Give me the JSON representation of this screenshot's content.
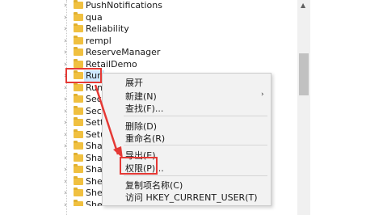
{
  "tree": {
    "items": [
      {
        "label": "PushNotifications"
      },
      {
        "label": "qua"
      },
      {
        "label": "Reliability"
      },
      {
        "label": "rempl"
      },
      {
        "label": "ReserveManager"
      },
      {
        "label": "RetailDemo"
      },
      {
        "label": "Run",
        "selected": true
      },
      {
        "label": "RunO"
      },
      {
        "label": "Secor"
      },
      {
        "label": "Secur"
      },
      {
        "label": "Settin"
      },
      {
        "label": "Setup"
      },
      {
        "label": "Share"
      },
      {
        "label": "Share"
      },
      {
        "label": "Share"
      },
      {
        "label": "Shell"
      },
      {
        "label": "Shell"
      },
      {
        "label": "ShellCompatibility"
      }
    ]
  },
  "context_menu": {
    "items": [
      {
        "label": "展开",
        "name": "menu-item-expand"
      },
      {
        "label": "新建(N)",
        "name": "menu-item-new",
        "has_submenu": true
      },
      {
        "label": "查找(F)...",
        "name": "menu-item-find"
      },
      {
        "separator": true
      },
      {
        "label": "删除(D)",
        "name": "menu-item-delete"
      },
      {
        "label": "重命名(R)",
        "name": "menu-item-rename"
      },
      {
        "separator": true
      },
      {
        "label": "导出(E)",
        "name": "menu-item-export"
      },
      {
        "label": "权限(P)...",
        "name": "menu-item-permissions"
      },
      {
        "separator": true
      },
      {
        "label": "复制项名称(C)",
        "name": "menu-item-copy-key-name"
      },
      {
        "label": "访问 HKEY_CURRENT_USER(T)",
        "name": "menu-item-goto-hkcu"
      }
    ]
  },
  "colors": {
    "highlight_box": "#e53935",
    "folder": "#f0c040",
    "selection": "#cde8ff",
    "menu_background": "#f2f2f2"
  }
}
